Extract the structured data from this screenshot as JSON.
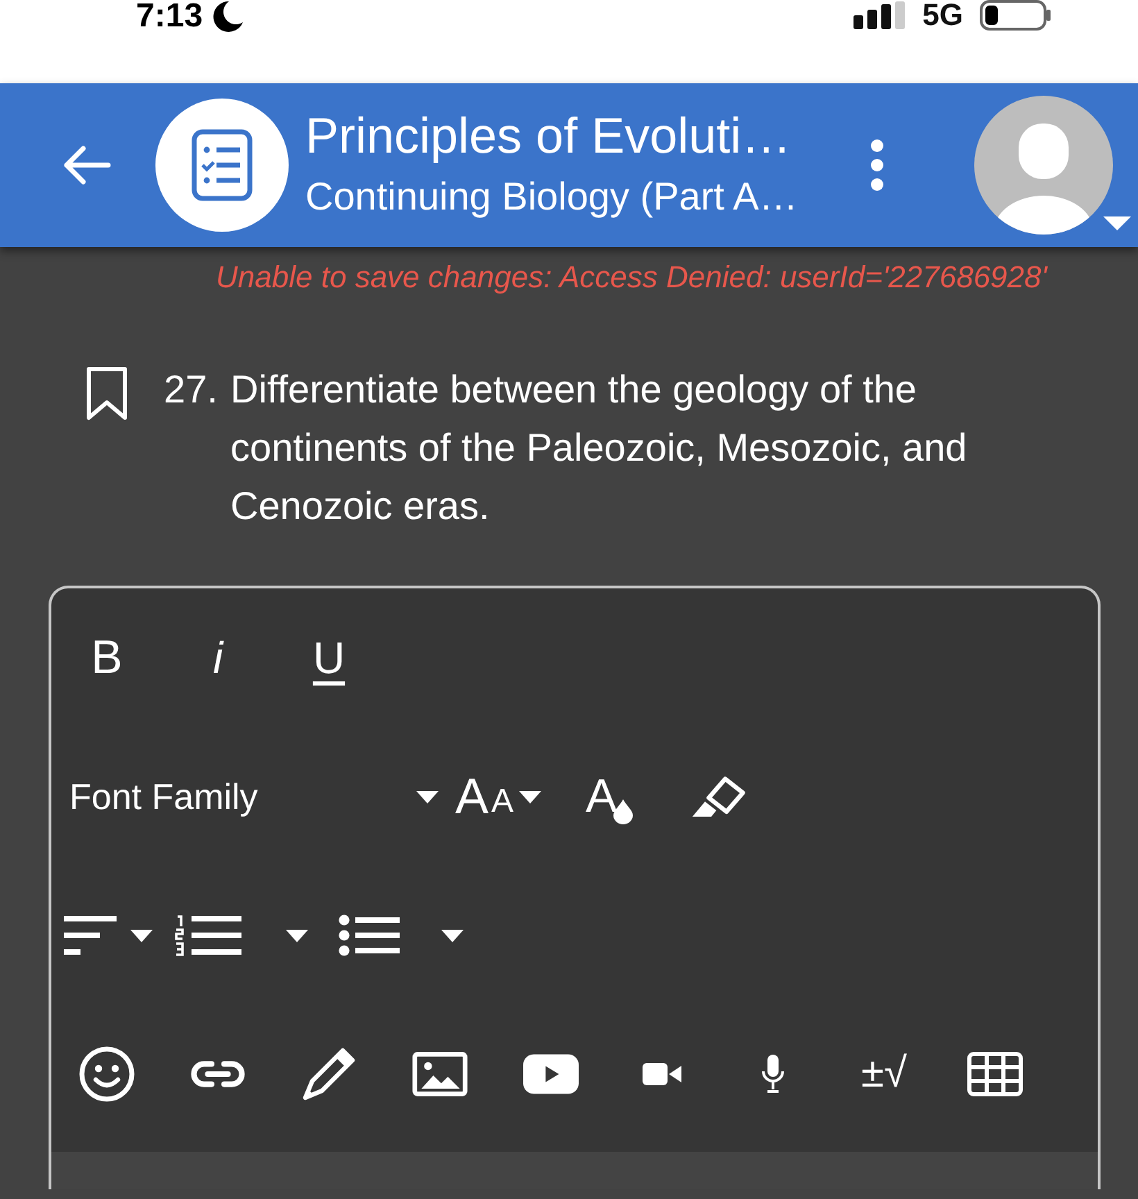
{
  "status_bar": {
    "time": "7:13",
    "network": "5G"
  },
  "header": {
    "title": "Principles of Evoluti…",
    "subtitle": "Continuing Biology (Part A…"
  },
  "error_message": "Unable to save changes: Access Denied: userId='227686928'",
  "question": {
    "number": "27.",
    "text": "Differentiate between the geology of the continents of the Paleozoic, Mesozoic, and Cenozoic eras.",
    "bookmarked": false
  },
  "editor": {
    "toolbar": [
      [
        {
          "kind": "bold",
          "label": "B"
        },
        {
          "kind": "italic",
          "label": "i"
        },
        {
          "kind": "underline",
          "label": "U"
        }
      ],
      [
        {
          "kind": "font-family",
          "label": "Font Family",
          "dropdown": true
        },
        {
          "kind": "font-size",
          "glyphs": [
            "A",
            "A"
          ],
          "dropdown": true
        },
        {
          "kind": "font-color",
          "label": "A"
        },
        {
          "kind": "highlight"
        }
      ],
      [
        {
          "kind": "align",
          "dropdown": true
        },
        {
          "kind": "numbered-list",
          "dropdown": true
        },
        {
          "kind": "bulleted-list",
          "dropdown": true
        }
      ],
      [
        {
          "kind": "emoji"
        },
        {
          "kind": "link"
        },
        {
          "kind": "draw"
        },
        {
          "kind": "image"
        },
        {
          "kind": "video-embed"
        },
        {
          "kind": "video"
        },
        {
          "kind": "audio"
        },
        {
          "kind": "math",
          "label": "±√"
        },
        {
          "kind": "table"
        }
      ]
    ]
  }
}
